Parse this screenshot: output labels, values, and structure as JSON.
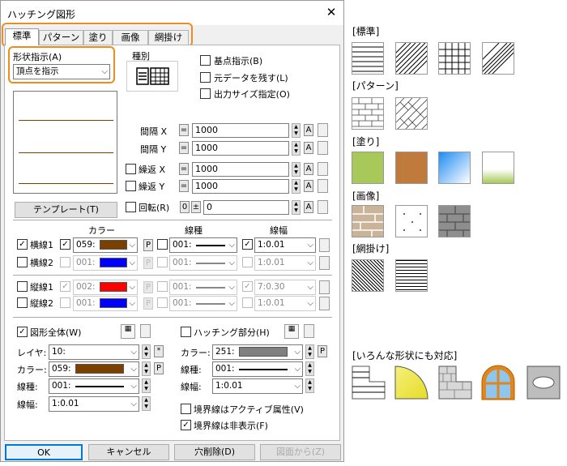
{
  "window": {
    "title": "ハッチング図形",
    "close": "✕"
  },
  "tabs": [
    "標準",
    "パターン",
    "塗り",
    "画像",
    "網掛け"
  ],
  "shape_spec": {
    "label": "形状指示(A)",
    "value": "頂点を指示"
  },
  "kind": {
    "label": "種別"
  },
  "checks_top": {
    "base_point": "基点指示(B)",
    "keep_data": "元データを残す(L)",
    "output_size": "出力サイズ指定(O)"
  },
  "template_button": "テンプレート(T)",
  "params": {
    "interval_x": {
      "label": "間隔 X",
      "value": "1000"
    },
    "interval_y": {
      "label": "間隔 Y",
      "value": "1000"
    },
    "repeat_x": {
      "label": "繰返 X",
      "value": "1000"
    },
    "repeat_y": {
      "label": "繰返 Y",
      "value": "1000"
    },
    "rotate": {
      "label": "回転(R)",
      "value": "0"
    },
    "eq": "=",
    "a": "A",
    "zero": "0",
    "pm": "±"
  },
  "line_headers": {
    "color": "カラー",
    "type": "線種",
    "width": "線幅"
  },
  "lines": [
    {
      "label": "横線1",
      "color_code": "059:",
      "color": "#7b3f00",
      "type": "001:",
      "width": "1:0.01",
      "on": true
    },
    {
      "label": "横線2",
      "color_code": "001:",
      "color": "#0000ff",
      "type": "001:",
      "width": "1:0.01",
      "on": false
    },
    {
      "label": "縦線1",
      "color_code": "002:",
      "color": "#ff0000",
      "type": "001:",
      "width": "7:0.30",
      "on": false
    },
    {
      "label": "縦線2",
      "color_code": "001:",
      "color": "#0000ff",
      "type": "001:",
      "width": "1:0.01",
      "on": false
    }
  ],
  "p": "P",
  "check": "✓",
  "whole": {
    "label": "図形全体(W)",
    "layer_label": "レイヤ:",
    "layer": "10:",
    "color_label": "カラー:",
    "color_code": "059:",
    "color": "#7b3f00",
    "type_label": "線種:",
    "type": "001:",
    "width_label": "線幅:",
    "width": "1:0.01",
    "star": "*"
  },
  "hatch_part": {
    "label": "ハッチング部分(H)",
    "color_label": "カラー:",
    "color_code": "251:",
    "color": "#808080",
    "type_label": "線種:",
    "type": "001:",
    "width_label": "線幅:",
    "width": "1:0.01"
  },
  "border_checks": {
    "active": "境界線はアクティブ属性(V)",
    "hidden": "境界線は非表示(F)"
  },
  "buttons": {
    "ok": "OK",
    "cancel": "キャンセル",
    "hole": "穴削除(D)",
    "from_fig": "図面から(Z)"
  },
  "right": {
    "standard": "[標準]",
    "pattern": "[パターン]",
    "fill": "[塗り]",
    "image": "[画像]",
    "halftone": "[網掛け]",
    "any_shape": "[いろんな形状にも対応]"
  },
  "colors": {
    "accent": "#f08c1e",
    "fill_green": "#a8c85a",
    "fill_brown": "#c07a3c",
    "sel_blue": "#0078d7"
  }
}
